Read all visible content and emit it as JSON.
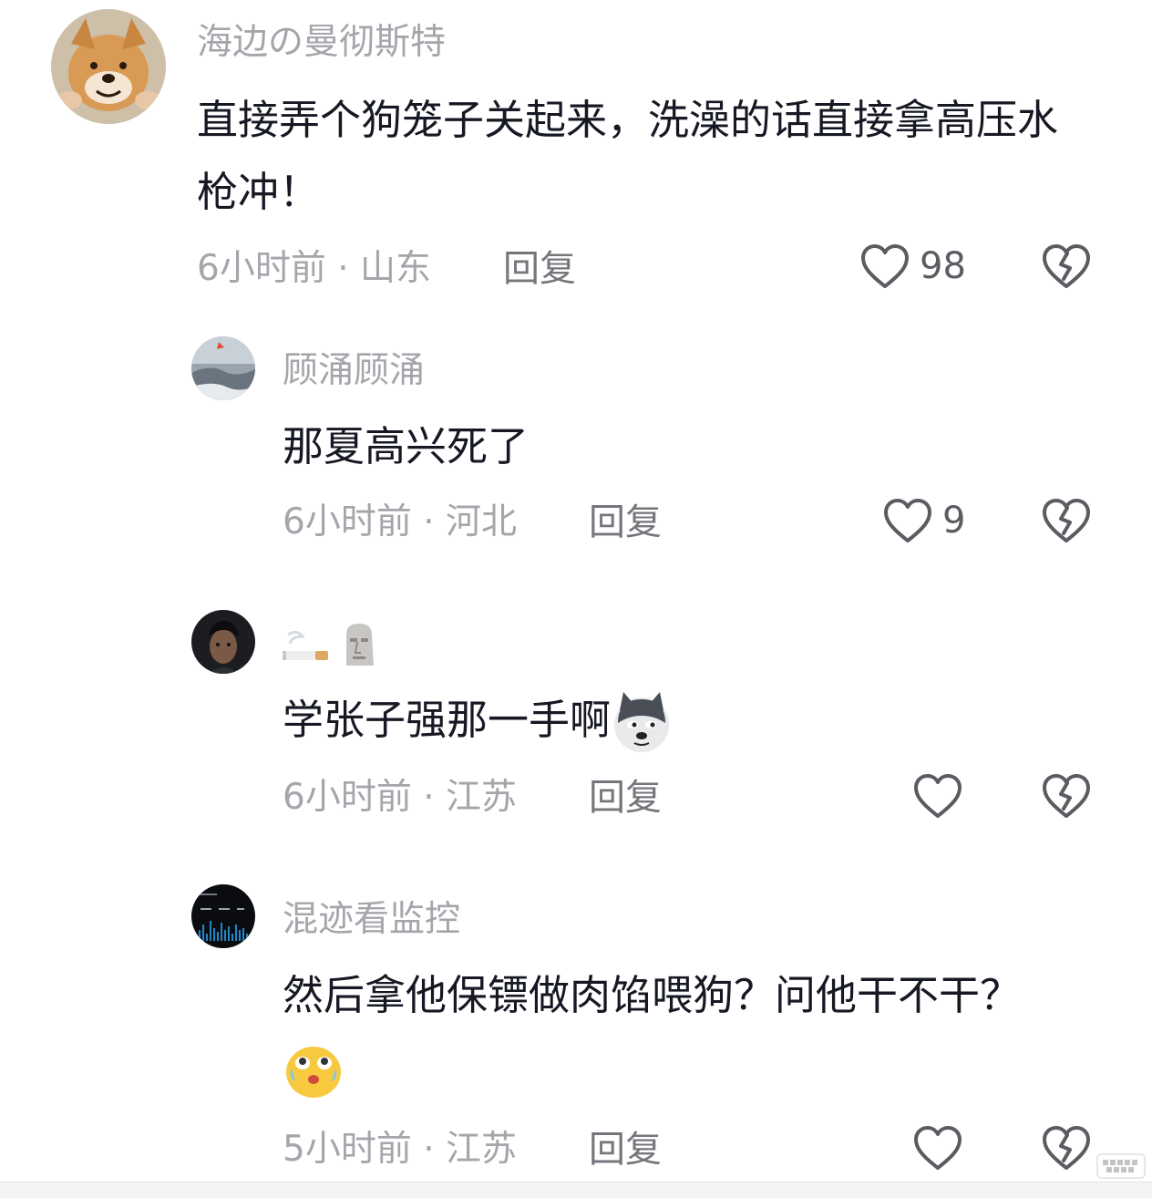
{
  "comments": [
    {
      "username": "海边の曼彻斯特",
      "content": "直接弄个狗笼子关起来，洗澡的话直接拿高压水枪冲！",
      "time": "6小时前",
      "location": "山东",
      "reply_label": "回复",
      "likes": "98"
    },
    {
      "username": "顾涌顾涌",
      "content": "那夏高兴死了",
      "time": "6小时前",
      "location": "河北",
      "reply_label": "回复",
      "likes": "9"
    },
    {
      "username_emojis": [
        "cigarette-emoji",
        "moai-emoji"
      ],
      "content": "学张子强那一手啊",
      "content_emoji": "husky-dog-emoji",
      "time": "6小时前",
      "location": "江苏",
      "reply_label": "回复",
      "likes": ""
    },
    {
      "username": "混迹看监控",
      "content": "然后拿他保镖做肉馅喂狗？问他干不干？",
      "content_emoji": "crying-laughing-face-emoji",
      "time": "5小时前",
      "location": "江苏",
      "reply_label": "回复",
      "likes": ""
    }
  ],
  "separator": " · ",
  "icons": {
    "like": "heart-outline-icon",
    "dislike": "broken-heart-icon"
  },
  "colors": {
    "username": "#a4a6ab",
    "text": "#161823",
    "meta": "#a4a6ab",
    "reply": "#74767c",
    "icon": "#5a5c62"
  }
}
